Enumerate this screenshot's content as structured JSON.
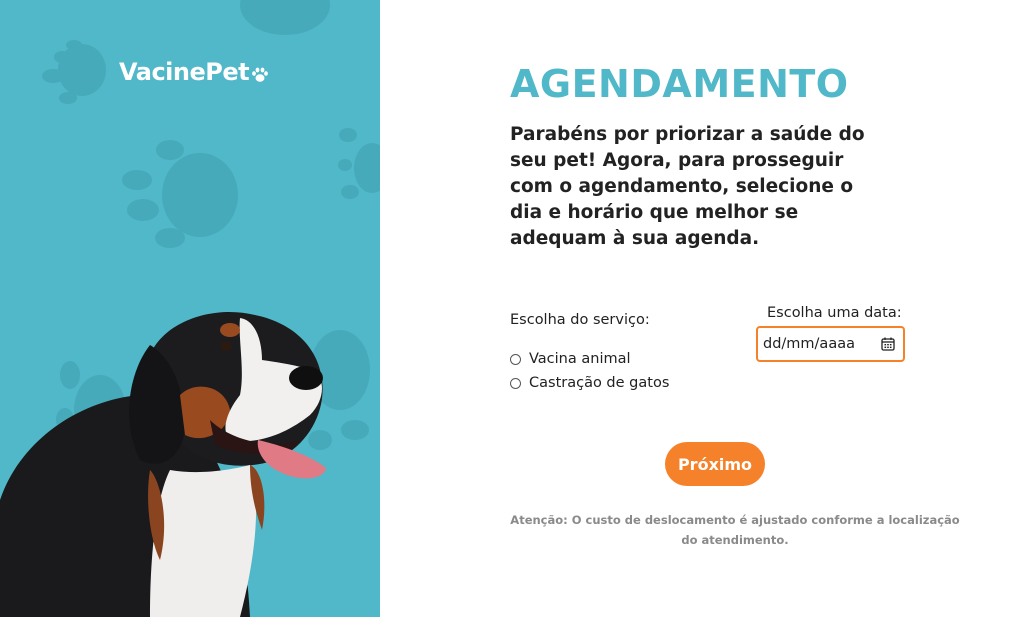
{
  "brand": {
    "name": "VacinePet",
    "logo_icon": "paw-icon"
  },
  "main": {
    "title": "AGENDAMENTO",
    "intro": "Parabéns por priorizar a saúde do seu pet! Agora, para prosseguir com o agendamento, selecione o dia e horário que melhor se adequam à sua agenda."
  },
  "form": {
    "service_label": "Escolha do serviço:",
    "services": [
      {
        "label": "Vacina animal",
        "selected": false
      },
      {
        "label": "Castração de gatos",
        "selected": false
      }
    ],
    "date_label": "Escolha uma data:",
    "date_placeholder": "dd/mm/aaaa",
    "date_icon": "calendar-icon",
    "next_button": "Próximo"
  },
  "notice": "Atenção: O custo de deslocamento é ajustado conforme a localização do atendimento.",
  "colors": {
    "panel": "#50b8c8",
    "accent": "#f5822a",
    "title": "#50b8c8",
    "text": "#222222",
    "notice": "#8a8a8a"
  }
}
